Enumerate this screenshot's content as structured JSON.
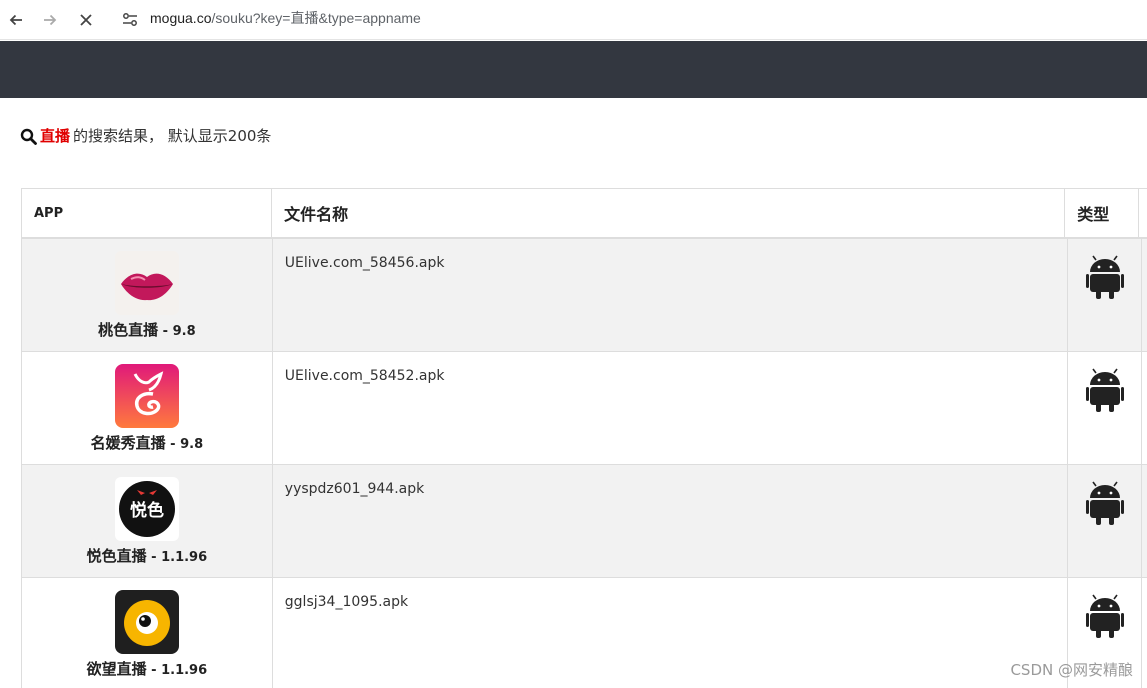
{
  "browser": {
    "url_host": "mogua.co",
    "url_path": "/souku?key=直播&type=appname",
    "icons": [
      "back-arrow-icon",
      "forward-arrow-icon",
      "stop-icon",
      "site-settings-icon"
    ]
  },
  "search": {
    "keyword": "直播",
    "result_text": "的搜索结果， 默认显示200条",
    "keyword_color": "#e00000"
  },
  "table": {
    "headers": [
      "APP",
      "文件名称",
      "类型"
    ],
    "rows": [
      {
        "app_name": "桃色直播",
        "rating": " - 9.8",
        "file": "UElive.com_58456.apk",
        "type_icon": "android-icon",
        "app_icon": "lips-icon"
      },
      {
        "app_name": "名媛秀直播",
        "rating": " - 9.8",
        "file": "UElive.com_58452.apk",
        "type_icon": "android-icon",
        "app_icon": "fox-logo-icon"
      },
      {
        "app_name": "悦色直播",
        "rating": " - 1.1.96",
        "file": "yyspdz601_944.apk",
        "type_icon": "android-icon",
        "app_icon": "yuese-logo-icon"
      },
      {
        "app_name": "欲望直播",
        "rating": " - 1.1.96",
        "file": "gglsj34_1095.apk",
        "type_icon": "android-icon",
        "app_icon": "eye-logo-icon"
      }
    ]
  },
  "header_color": "#333740",
  "watermark": "CSDN @网安精酿"
}
